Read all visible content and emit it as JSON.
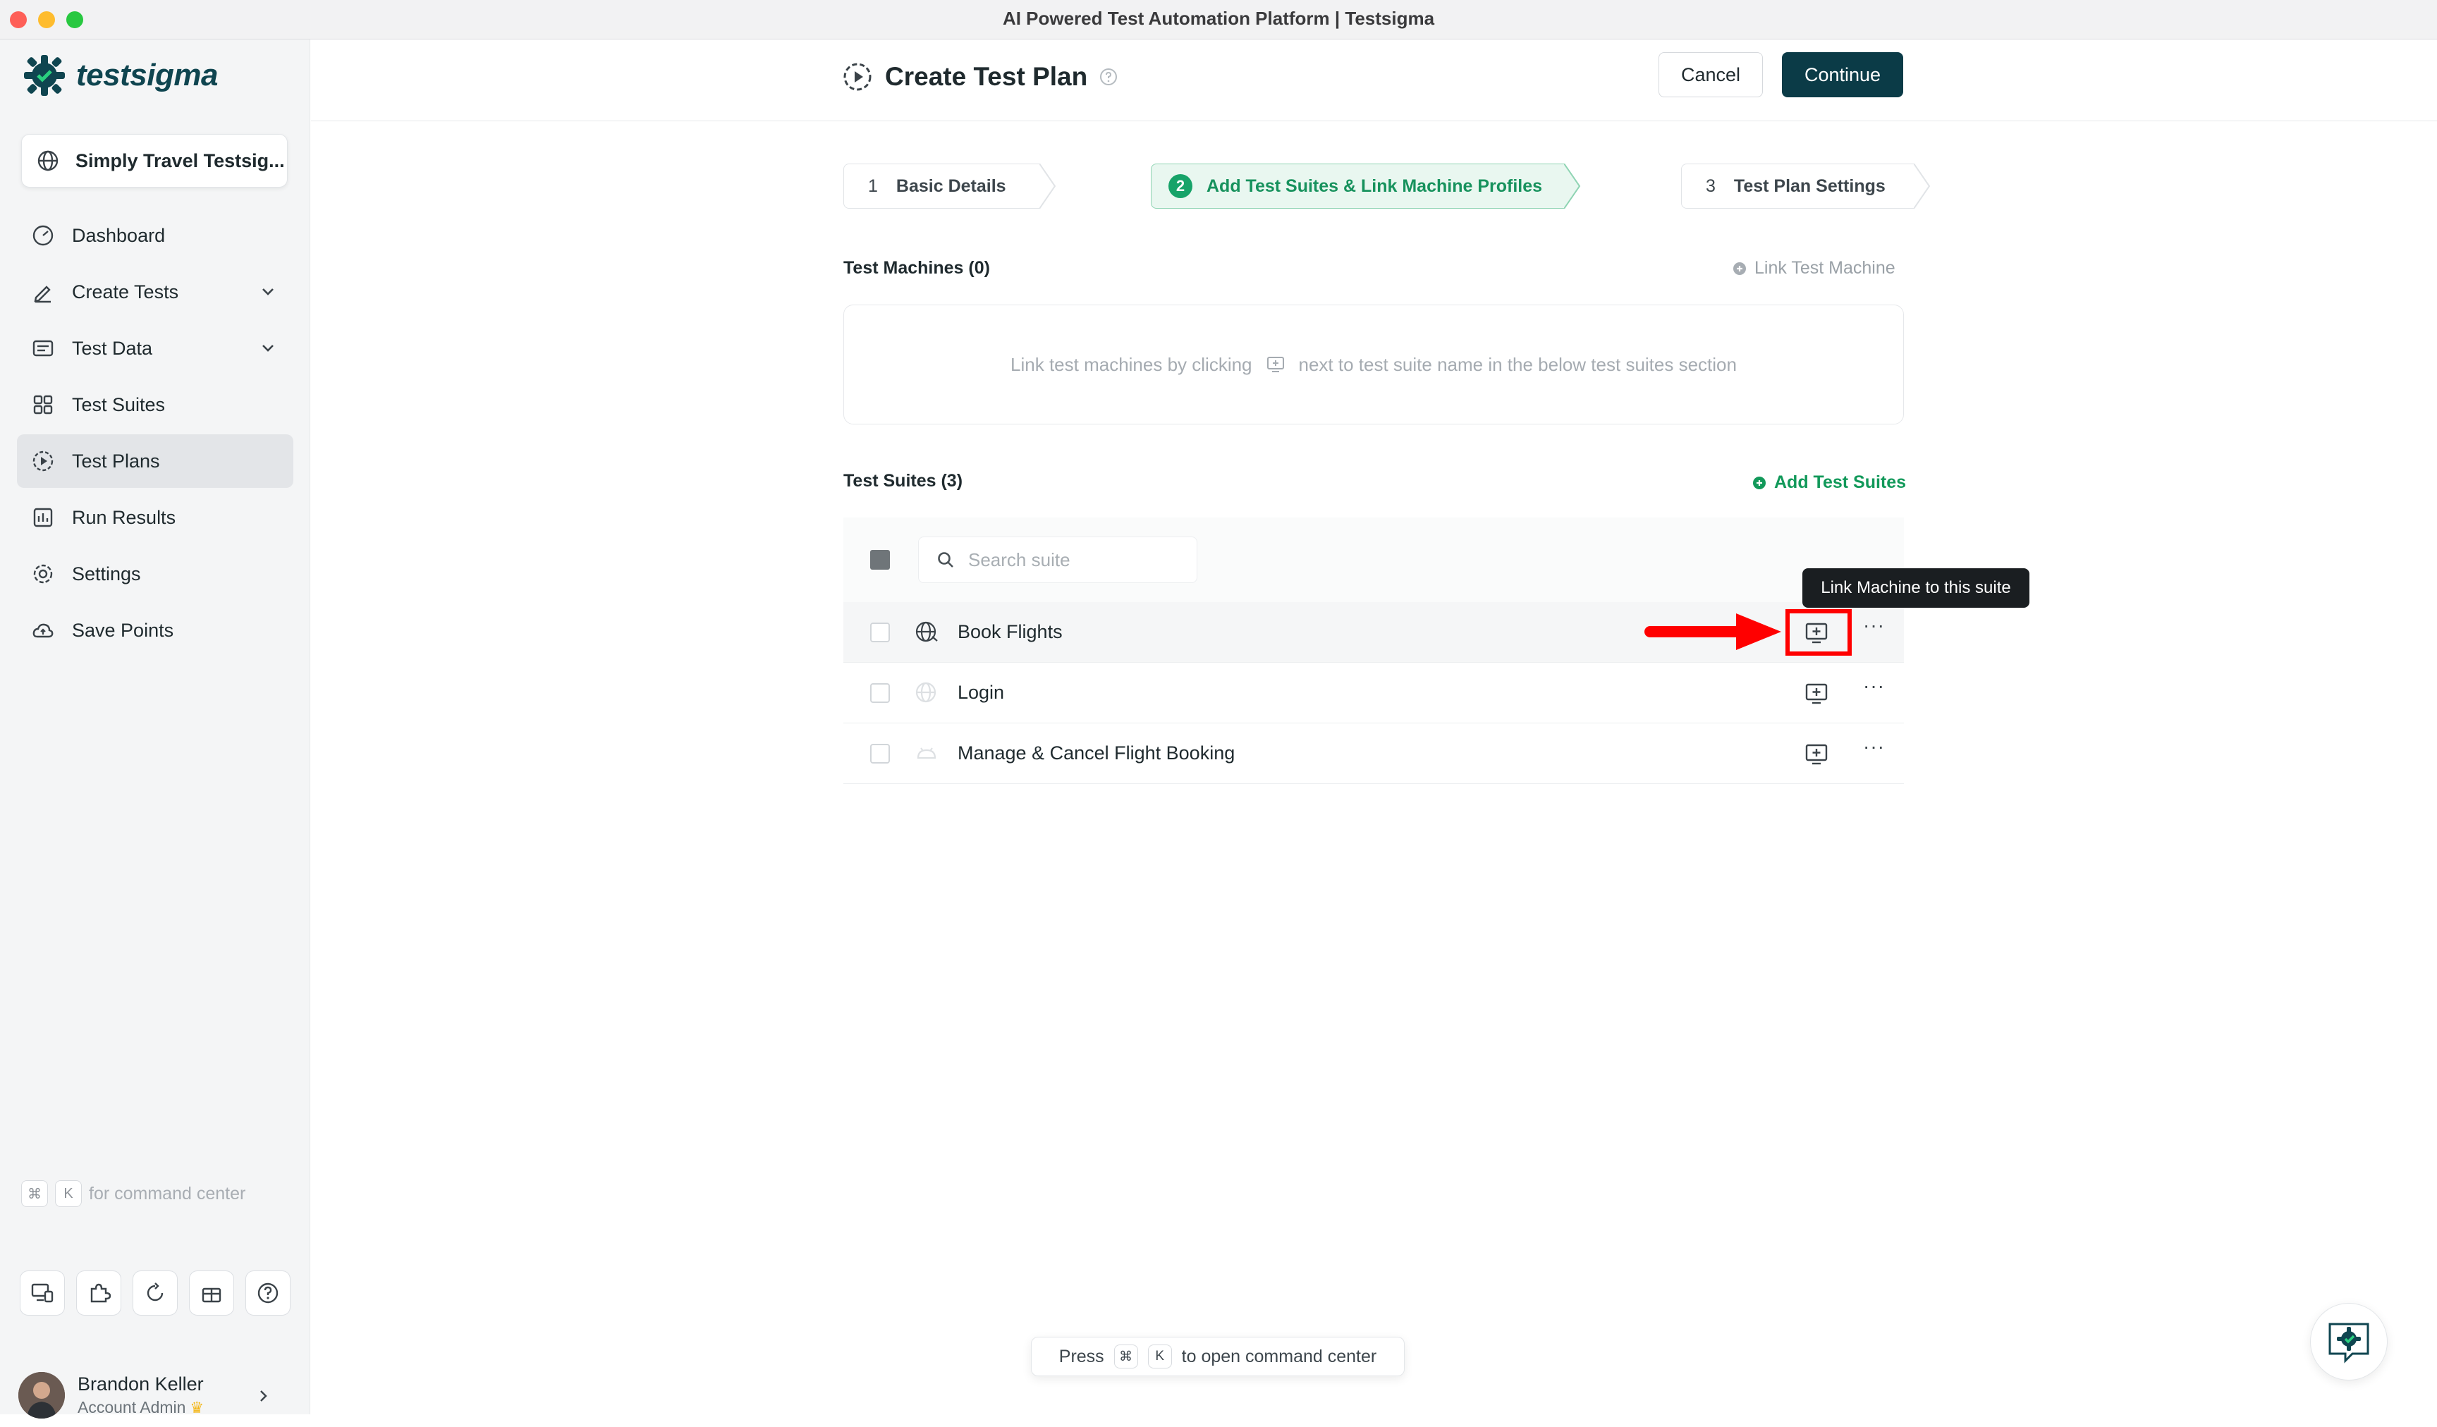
{
  "window": {
    "title": "AI Powered Test Automation Platform | Testsigma"
  },
  "brand": {
    "name": "testsigma",
    "color": "#0f4550",
    "accent": "#17a369"
  },
  "sidebar": {
    "workspace": "Simply Travel Testsig...",
    "items": [
      {
        "label": "Dashboard",
        "icon": "gauge-icon"
      },
      {
        "label": "Create Tests",
        "icon": "pen-icon",
        "expandable": true
      },
      {
        "label": "Test Data",
        "icon": "table-icon",
        "expandable": true
      },
      {
        "label": "Test Suites",
        "icon": "grid-icon"
      },
      {
        "label": "Test Plans",
        "icon": "play-circle-icon",
        "active": true
      },
      {
        "label": "Run Results",
        "icon": "bar-chart-icon"
      },
      {
        "label": "Settings",
        "icon": "gear-icon"
      },
      {
        "label": "Save Points",
        "icon": "cloud-icon"
      }
    ],
    "command_hint": {
      "key1": "⌘",
      "key2": "K",
      "text": "for command center"
    },
    "user": {
      "name": "Brandon Keller",
      "role": "Account Admin"
    }
  },
  "header": {
    "title": "Create Test Plan",
    "cancel_label": "Cancel",
    "continue_label": "Continue"
  },
  "steps": [
    {
      "number": "1",
      "label": "Basic Details"
    },
    {
      "number": "2",
      "label": "Add Test Suites & Link Machine Profiles",
      "active": true
    },
    {
      "number": "3",
      "label": "Test Plan Settings"
    }
  ],
  "machines": {
    "title": "Test Machines (0)",
    "link_label": "Link Test Machine",
    "empty_before": "Link test machines by clicking",
    "empty_after": "next to test suite name in the below test suites section"
  },
  "suites": {
    "title": "Test Suites (3)",
    "add_label": "Add Test Suites",
    "search_placeholder": "Search suite",
    "rows": [
      {
        "name": "Book Flights",
        "icon": "web-globe-icon"
      },
      {
        "name": "Login",
        "icon": "web-globe-icon"
      },
      {
        "name": "Manage & Cancel Flight Booking",
        "icon": "android-icon"
      }
    ],
    "more_label": "···"
  },
  "tooltip": {
    "text": "Link Machine to this suite"
  },
  "command_toast": {
    "press": "Press",
    "key1": "⌘",
    "key2": "K",
    "text": "to open command center"
  }
}
